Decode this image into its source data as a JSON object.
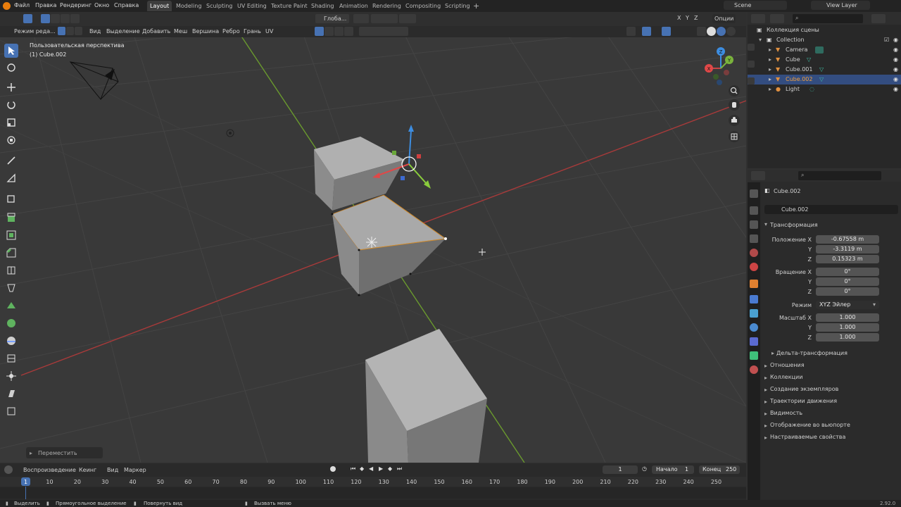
{
  "menubar": {
    "items": [
      "Файл",
      "Правка",
      "Рендеринг",
      "Окно",
      "Справка"
    ],
    "workspaces": [
      "Layout",
      "Modeling",
      "Sculpting",
      "UV Editing",
      "Texture Paint",
      "Shading",
      "Animation",
      "Rendering",
      "Compositing",
      "Scripting"
    ],
    "add_tab": "+",
    "scene": "Scene",
    "view_layer": "View Layer"
  },
  "viewport_header": {
    "mode": "Режим реда...",
    "menus": [
      "Вид",
      "Выделение",
      "Добавить",
      "Меш",
      "Вершина",
      "Ребро",
      "Грань",
      "UV"
    ],
    "orientation": "Глоба...",
    "axes": [
      "X",
      "Y",
      "Z"
    ],
    "options": "Опции"
  },
  "viewport": {
    "view_name": "Пользовательская перспектива",
    "object_name": "(1) Cube.002",
    "operator_panel": "Переместить",
    "gizmo_axes": [
      "X",
      "Y",
      "Z"
    ]
  },
  "outliner": {
    "title": "Коллекция сцены",
    "items": [
      {
        "label": "Collection",
        "level": 1,
        "selected": false
      },
      {
        "label": "Camera",
        "level": 2,
        "selected": false
      },
      {
        "label": "Cube",
        "level": 2,
        "selected": false
      },
      {
        "label": "Cube.001",
        "level": 2,
        "selected": false
      },
      {
        "label": "Cube.002",
        "level": 2,
        "selected": true
      },
      {
        "label": "Light",
        "level": 2,
        "selected": false
      }
    ]
  },
  "properties": {
    "object_name": "Cube.002",
    "object_field": "Cube.002",
    "transform_title": "Трансформация",
    "location_label": "Положение X",
    "location": [
      "-0.67558 m",
      "-3.3119 m",
      "0.15323 m"
    ],
    "rotation_label": "Вращение X",
    "rotation": [
      "0°",
      "0°",
      "0°"
    ],
    "axis_y": "Y",
    "axis_z": "Z",
    "mode_label": "Режим",
    "mode_value": "XYZ Эйлер",
    "scale_label": "Масштаб X",
    "scale": [
      "1.000",
      "1.000",
      "1.000"
    ],
    "delta": "Дельта-трансформация",
    "sections": [
      "Отношения",
      "Коллекции",
      "Создание экземпляров",
      "Траектории движения",
      "Видимость",
      "Отображение во вьюпорте",
      "Настраиваемые свойства"
    ]
  },
  "timeline": {
    "playback": "Воспроизведение",
    "keying": "Кеинг",
    "view": "Вид",
    "marker": "Маркер",
    "current_frame": "1",
    "start_label": "Начало",
    "start": "1",
    "end_label": "Конец",
    "end": "250",
    "ticks": [
      "1",
      "10",
      "20",
      "30",
      "40",
      "50",
      "60",
      "70",
      "80",
      "90",
      "100",
      "110",
      "120",
      "130",
      "140",
      "150",
      "160",
      "170",
      "180",
      "190",
      "200",
      "210",
      "220",
      "230",
      "240",
      "250"
    ]
  },
  "statusbar": {
    "select": "Выделить",
    "box_select": "Прямоугольное выделение",
    "rotate_view": "Повернуть вид",
    "call_menu": "Вызвать меню",
    "version": "2.92.0"
  },
  "colors": {
    "accent": "#4772b3",
    "x_axis": "#c84545",
    "y_axis": "#7ab33c",
    "z_axis": "#3d8de0"
  }
}
